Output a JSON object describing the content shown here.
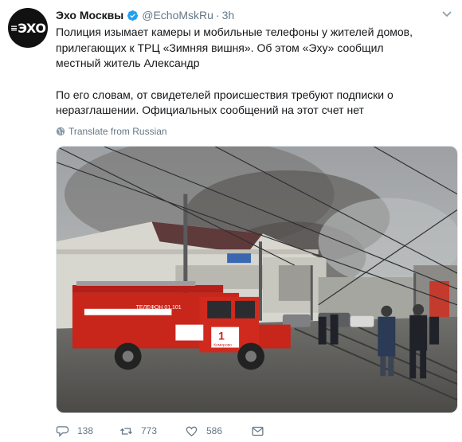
{
  "account": {
    "name": "Эхо Москвы",
    "handle": "@EchoMskRu",
    "separator": "·",
    "time": "3h",
    "avatar_text": "ЭХО",
    "verified_icon": "verified-badge-icon"
  },
  "tweet": {
    "paragraph1": "Полиция изымает камеры и мобильные телефоны у жителей домов, прилегающих к ТРЦ «Зимняя вишня». Об этом «Эху» сообщил местный житель Александр",
    "paragraph2": "По его словам, от свидетелей происшествия требуют подписки о неразглашении. Официальных сообщений на этот счет нет",
    "translate_label": "Translate from Russian"
  },
  "media": {
    "truck_side_text": "ТЕЛЕФОН 01,101",
    "truck_number": "1",
    "truck_city": "Кемерово"
  },
  "actions": {
    "replies": "138",
    "retweets": "773",
    "likes": "586"
  },
  "colors": {
    "link_gray": "#657786",
    "verified_blue": "#1da1f2",
    "truck_red": "#c8251b"
  }
}
